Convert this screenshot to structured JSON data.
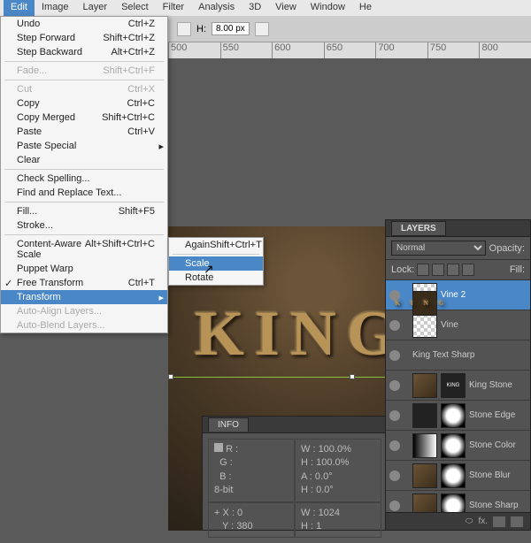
{
  "menubar": [
    "Edit",
    "Image",
    "Layer",
    "Select",
    "Filter",
    "Analysis",
    "3D",
    "View",
    "Window",
    "He"
  ],
  "toolbar": {
    "hlabel": "H:",
    "hval": "8.00 px"
  },
  "ruler": [
    "500",
    "550",
    "600",
    "650",
    "700",
    "750",
    "800"
  ],
  "edit_menu": [
    {
      "l": "Undo",
      "s": "Ctrl+Z"
    },
    {
      "l": "Step Forward",
      "s": "Shift+Ctrl+Z"
    },
    {
      "l": "Step Backward",
      "s": "Alt+Ctrl+Z"
    },
    {
      "sep": true
    },
    {
      "l": "Fade...",
      "s": "Shift+Ctrl+F",
      "d": true
    },
    {
      "sep": true
    },
    {
      "l": "Cut",
      "s": "Ctrl+X",
      "d": true
    },
    {
      "l": "Copy",
      "s": "Ctrl+C"
    },
    {
      "l": "Copy Merged",
      "s": "Shift+Ctrl+C"
    },
    {
      "l": "Paste",
      "s": "Ctrl+V"
    },
    {
      "l": "Paste Special",
      "sub": true
    },
    {
      "l": "Clear"
    },
    {
      "sep": true
    },
    {
      "l": "Check Spelling..."
    },
    {
      "l": "Find and Replace Text..."
    },
    {
      "sep": true
    },
    {
      "l": "Fill...",
      "s": "Shift+F5"
    },
    {
      "l": "Stroke..."
    },
    {
      "sep": true
    },
    {
      "l": "Content-Aware Scale",
      "s": "Alt+Shift+Ctrl+C"
    },
    {
      "l": "Puppet Warp"
    },
    {
      "l": "Free Transform",
      "s": "Ctrl+T",
      "chk": true
    },
    {
      "l": "Transform",
      "hl": true,
      "sub": true
    },
    {
      "l": "Auto-Align Layers...",
      "d": true
    },
    {
      "l": "Auto-Blend Layers...",
      "d": true
    }
  ],
  "submenu": [
    {
      "l": "Again",
      "s": "Shift+Ctrl+T"
    },
    {
      "sep": true
    },
    {
      "l": "Scale",
      "hl": true
    },
    {
      "l": "Rotate"
    }
  ],
  "king_text": "KING",
  "info": {
    "title": "INFO",
    "r": "R :",
    "g": "G :",
    "b": "B :",
    "bits": "8-bit",
    "wlab": "W :",
    "wval": "100.0%",
    "hlab": "H :",
    "hval": "100.0%",
    "alab": "A :",
    "aval": "0.0°",
    "hlab2": "H :",
    "hval2": "0.0°",
    "xlab": "X :",
    "xval": "0",
    "ylab": "Y :",
    "yval": "380",
    "wlab2": "W :",
    "wval2": "1024",
    "hlab3": "H :",
    "hval3": "1"
  },
  "layers": {
    "title": "LAYERS",
    "blend": "Normal",
    "opacity": "Opacity:",
    "lock": "Lock:",
    "fill": "Fill:",
    "items": [
      {
        "n": "Vine 2",
        "sel": true,
        "t": "chk"
      },
      {
        "n": "Vine",
        "t": "chk"
      },
      {
        "n": "King Text Sharp",
        "t": "king"
      },
      {
        "n": "King Stone",
        "t": "rock",
        "m": "dark"
      },
      {
        "n": "Stone Edge",
        "t": "dark",
        "m": "mask"
      },
      {
        "n": "Stone Color",
        "t": "grad",
        "m": "mask"
      },
      {
        "n": "Stone Blur",
        "t": "rock",
        "m": "mask"
      },
      {
        "n": "Stone Sharp",
        "t": "rock",
        "m": "mask"
      }
    ],
    "fx": "fx."
  }
}
